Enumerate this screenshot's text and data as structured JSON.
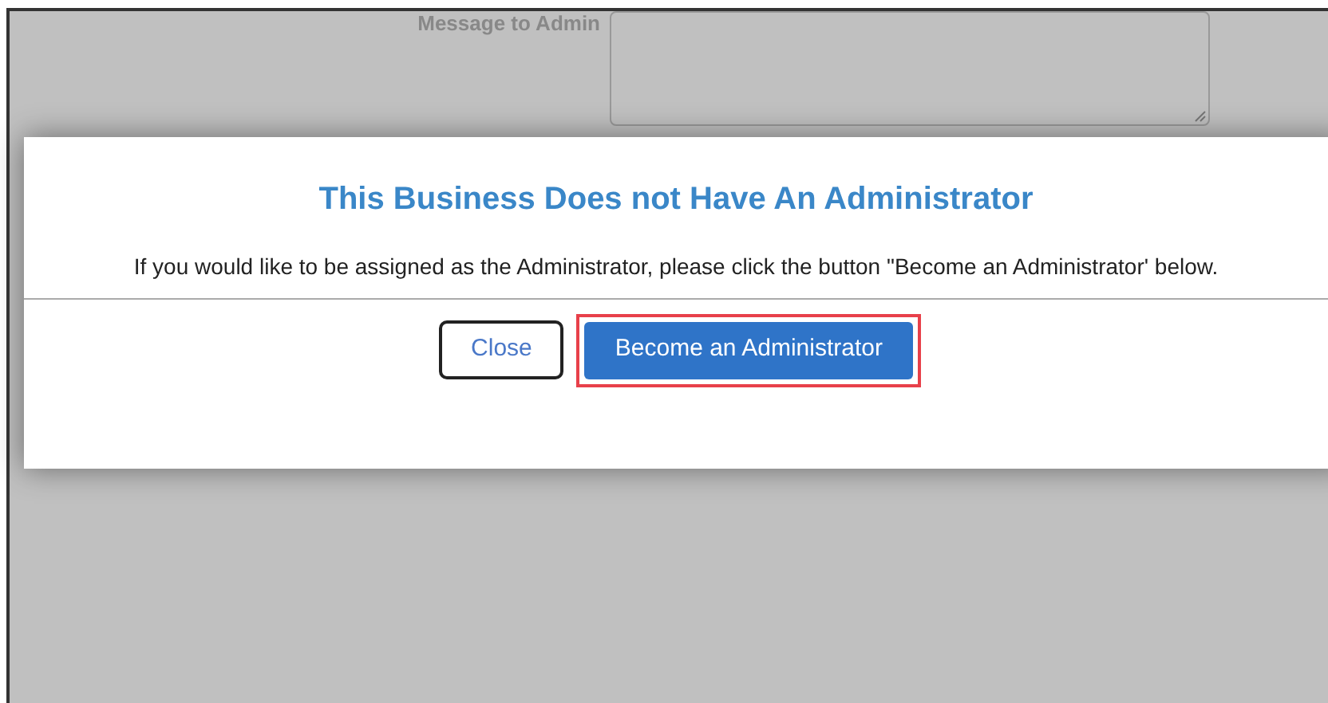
{
  "background_form": {
    "label": "Message to Admin"
  },
  "dialog": {
    "title": "This Business Does not Have An Administrator",
    "message": "If you would like to be assigned as the Administrator, please click the button \"Become an Administrator' below.",
    "buttons": [
      {
        "label": "Close",
        "kind": "secondary",
        "highlighted": false
      },
      {
        "label": "Become an Administrator",
        "kind": "primary",
        "highlighted": true
      }
    ]
  }
}
